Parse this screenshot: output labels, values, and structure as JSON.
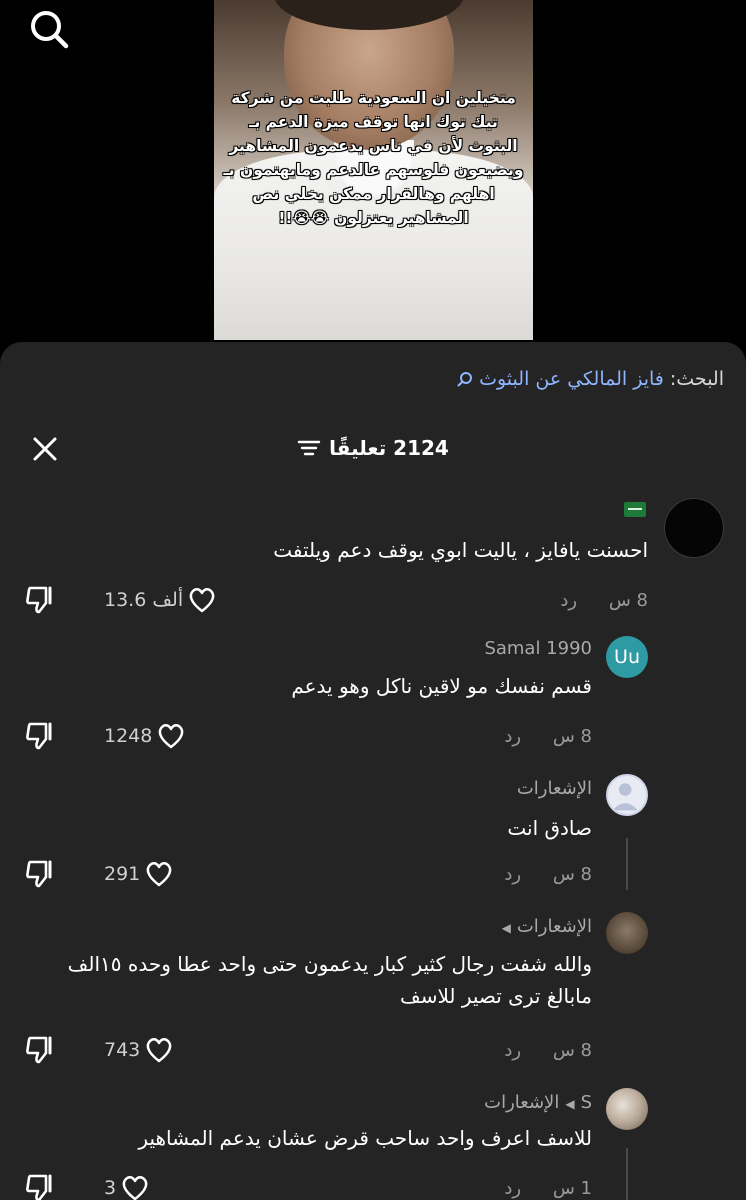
{
  "video": {
    "caption_lines": [
      "متخيلين ان السعودية طلبت من شركة",
      "تيك توك انها توقف ميزة الدعم بـ",
      "البثوث لأن في ناس يدعمون المشاهير",
      "ويضيعون فلوسهم عالدعم ومايهتمون بـ",
      "اهلهم وهالقرار ممكن يخلي نص",
      "المشاهير يعتزلون 😭😭!!"
    ]
  },
  "search": {
    "label": "البحث:",
    "query": "فايز المالكي عن البثوث"
  },
  "header": {
    "count": "2124 تعليقًا"
  },
  "comments": [
    {
      "author": "",
      "text": "احسنت يافايز ، ياليت ابوي يوقف دعم ويلتفت",
      "time": "8 س",
      "reply": "رد",
      "likes": "13.6 ألف"
    },
    {
      "author": "Samal 1990",
      "avatar_text": "Uu",
      "text": "قسم نفسك مو لاقين ناكل وهو يدعم",
      "time": "8 س",
      "reply": "رد",
      "likes": "1248"
    },
    {
      "author": "الإشعارات",
      "text": "صادق انت",
      "time": "8 س",
      "reply": "رد",
      "likes": "291"
    },
    {
      "author": "الإشعارات",
      "text_lines": [
        "والله شفت رجال كثير كبار يدعمون حتى واحد عطا وحده ١٥الف",
        "مابالغ ترى تصير للاسف"
      ],
      "time": "8 س",
      "reply": "رد",
      "likes": "743"
    },
    {
      "author_prefix": "S",
      "author": "الإشعارات",
      "text": "للاسف اعرف واحد ساحب قرض عشان يدعم المشاهير",
      "time": "1 س",
      "reply": "رد",
      "likes": "3"
    }
  ],
  "colors": {
    "sheet_bg": "#242424",
    "accent_link": "#8fb5ff",
    "avatar_teal": "#2e9aa3"
  }
}
